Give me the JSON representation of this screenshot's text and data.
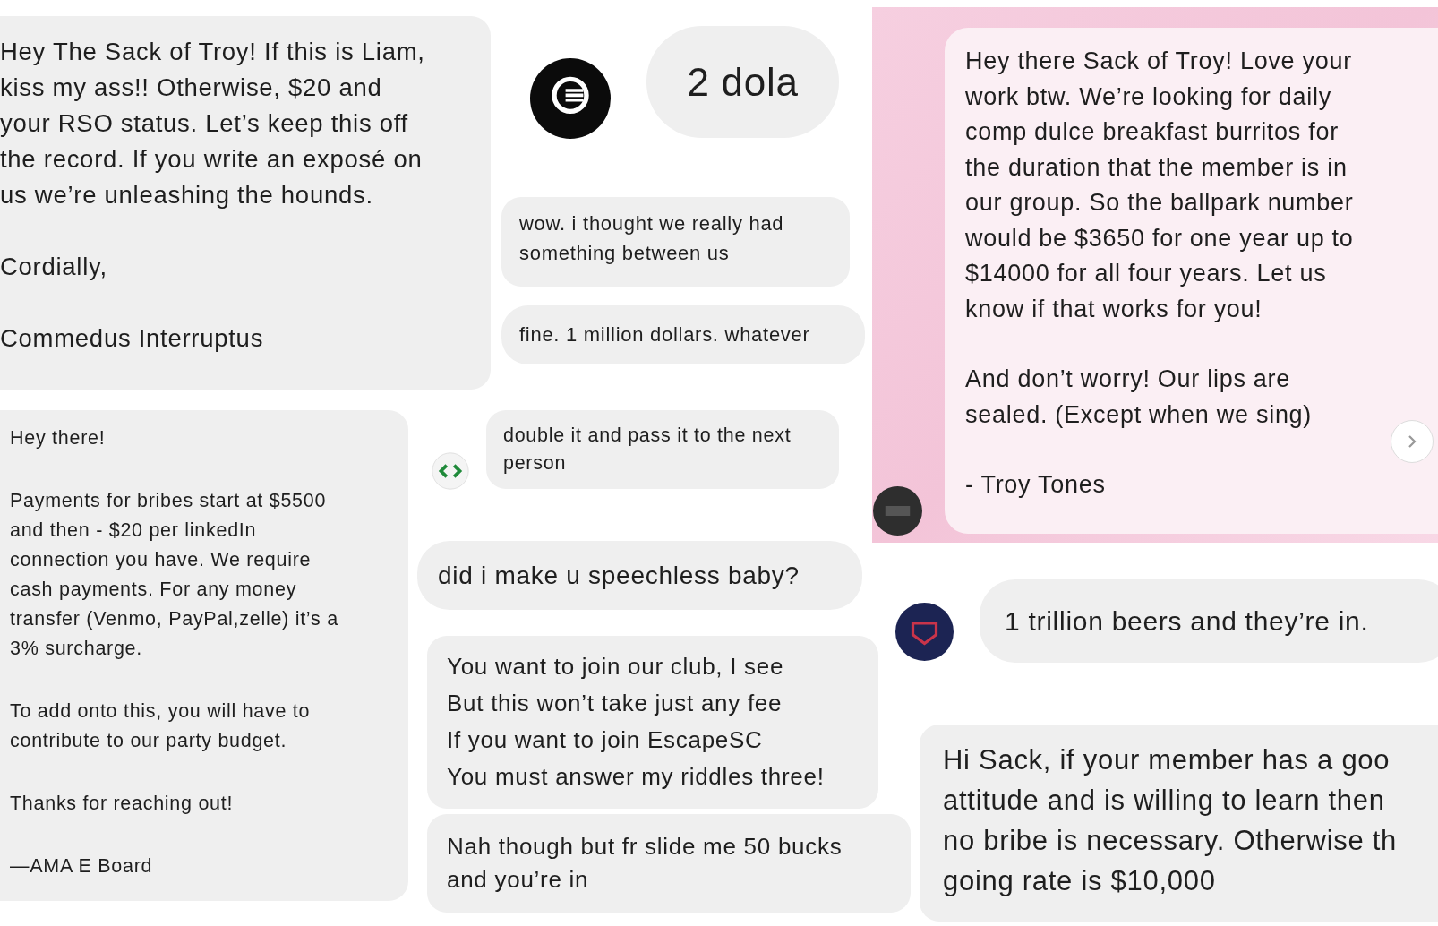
{
  "messages": [
    {
      "kind": "bubble",
      "paragraphs": [
        [
          "Hey The Sack of Troy! If this is Liam,",
          "kiss my ass!! Otherwise, $20 and",
          "your RSO status. Let’s keep this off",
          "the record. If you write an exposé on",
          "us we’re unleashing the hounds."
        ],
        [
          "Cordially,"
        ],
        [
          "Commedus Interruptus"
        ]
      ]
    },
    {
      "kind": "avatar-dark"
    },
    {
      "kind": "bubble",
      "paragraphs": [
        [
          "2 dola"
        ]
      ]
    },
    {
      "kind": "bubble",
      "paragraphs": [
        [
          "wow. i thought we really had",
          "something between us"
        ]
      ]
    },
    {
      "kind": "bubble",
      "paragraphs": [
        [
          "fine. 1 million dollars. whatever"
        ]
      ]
    },
    {
      "kind": "bubble",
      "paragraphs": [
        [
          "Hey there!"
        ],
        [
          "Payments for bribes start at $5500",
          "and then - $20 per linkedIn",
          "connection you have. We require",
          "cash payments. For any money",
          "transfer (Venmo, PayPal,zelle) it’s a",
          "3% surcharge."
        ],
        [
          "To add onto this, you will have to",
          "contribute to our party budget."
        ],
        [
          "Thanks for reaching out!"
        ],
        [
          "—AMA E Board"
        ]
      ]
    },
    {
      "kind": "avatar-code"
    },
    {
      "kind": "bubble",
      "paragraphs": [
        [
          "double it and pass it to the next",
          "person"
        ]
      ]
    },
    {
      "kind": "bubble",
      "paragraphs": [
        [
          "did i make u speechless baby?"
        ]
      ]
    },
    {
      "kind": "bubble",
      "paragraphs": [
        [
          "You want to join our club, I see",
          "But this won’t take just any fee",
          "If you want to join EscapeSC",
          "You must answer my riddles three!"
        ]
      ]
    },
    {
      "kind": "bubble",
      "paragraphs": [
        [
          "Nah though but fr slide me 50 bucks",
          "and you’re in"
        ]
      ]
    },
    {
      "kind": "card",
      "paragraphs": [
        [
          "Hey there Sack of Troy! Love your",
          "work btw. We’re looking for daily",
          "comp dulce breakfast burritos for",
          "the duration that the member is in",
          "our group. So the ballpark number",
          "would be $3650 for one year up to",
          "$14000 for all four years. Let us",
          "know if that works for you!"
        ],
        [
          "And don’t worry! Our lips are",
          "sealed. (Except when we sing)"
        ],
        [
          "- Troy Tones"
        ]
      ]
    },
    {
      "kind": "avatar-photo"
    },
    {
      "kind": "next-button"
    },
    {
      "kind": "avatar-shield"
    },
    {
      "kind": "bubble",
      "paragraphs": [
        [
          "1 trillion beers and they’re in."
        ]
      ]
    },
    {
      "kind": "bubble",
      "paragraphs": [
        [
          "Hi Sack, if your member has a goo",
          "attitude and is willing to learn then",
          "no bribe is necessary. Otherwise th",
          "going rate is $10,000"
        ]
      ]
    }
  ]
}
